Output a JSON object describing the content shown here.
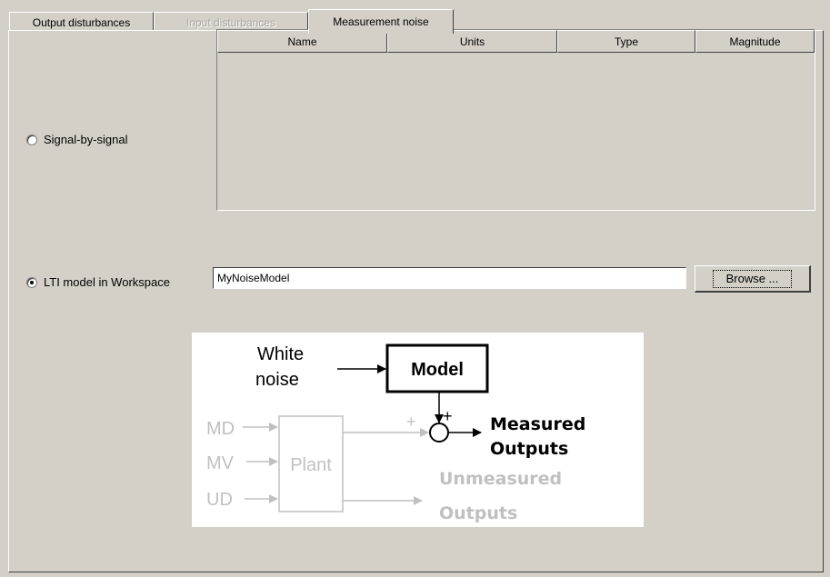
{
  "tabs": [
    {
      "label": "Output disturbances",
      "state": "normal"
    },
    {
      "label": "Input disturbances",
      "state": "disabled"
    },
    {
      "label": "Measurement noise",
      "state": "active"
    }
  ],
  "signal_option": {
    "label": "Signal-by-signal",
    "selected": false
  },
  "table": {
    "columns": [
      "Name",
      "Units",
      "Type",
      "Magnitude"
    ],
    "rows": []
  },
  "lti_option": {
    "label": "LTI model in Workspace",
    "selected": true
  },
  "model_field": {
    "value": "MyNoiseModel"
  },
  "browse_button": {
    "label": "Browse ..."
  },
  "diagram": {
    "white_noise_line1": "White",
    "white_noise_line2": "noise",
    "model_label": "Model",
    "plus_left": "+",
    "plus_top": "+",
    "measured_line1": "Measured",
    "measured_line2": "Outputs",
    "unmeasured_line1": "Unmeasured",
    "unmeasured_line2": "Outputs",
    "md_label": "MD",
    "mv_label": "MV",
    "ud_label": "UD",
    "plant_label": "Plant",
    "colors": {
      "active": "#000000",
      "inactive": "#c0c0c0"
    }
  }
}
